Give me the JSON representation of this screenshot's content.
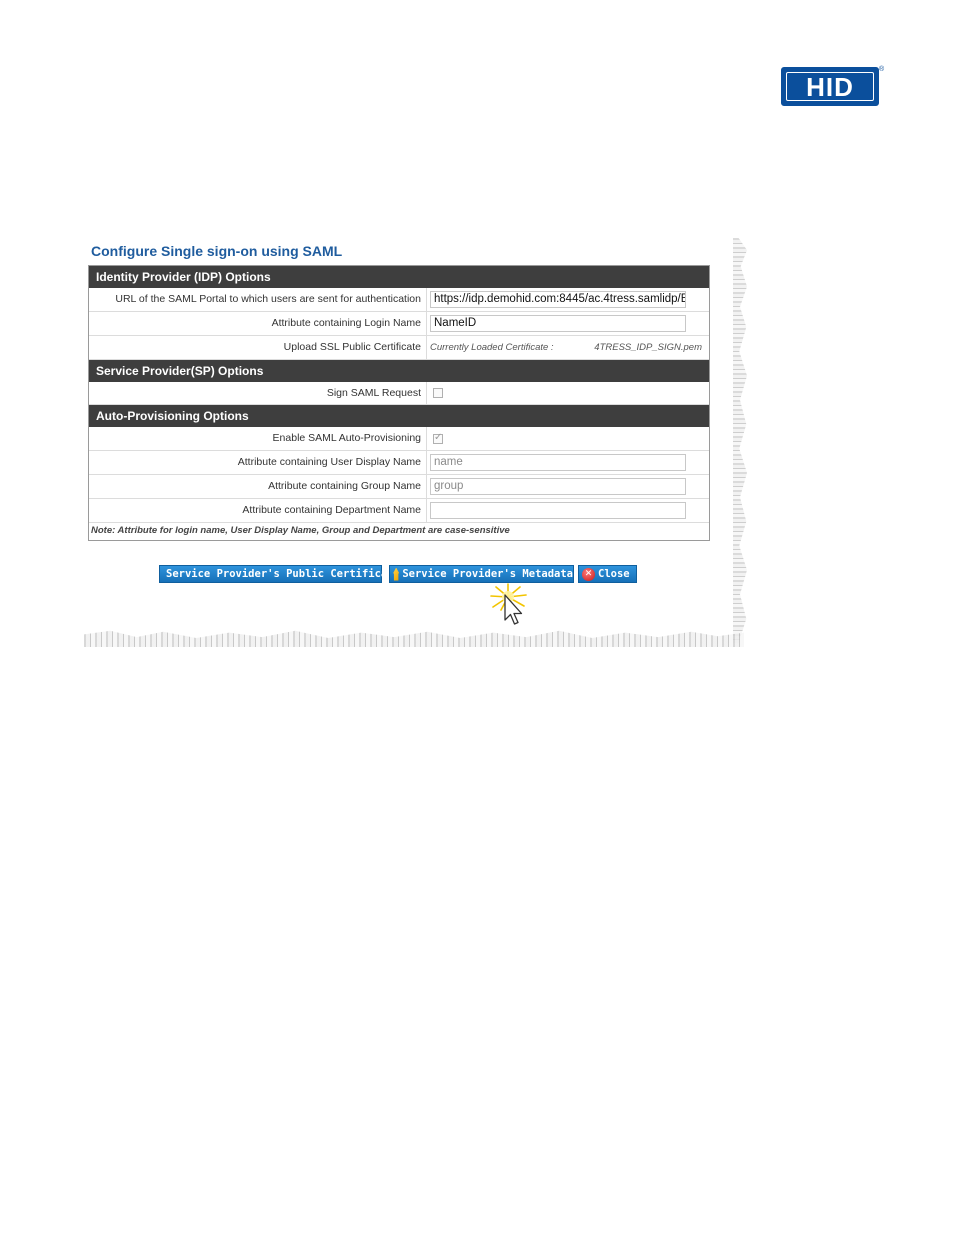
{
  "logo": {
    "text": "HID",
    "registered": "®"
  },
  "form": {
    "title": "Configure Single sign-on using SAML",
    "sections": {
      "idp": {
        "title": "Identity Provider (IDP) Options",
        "portal_url_label": "URL of the SAML Portal to which users are sent for authentication",
        "portal_url_value": "https://idp.demohid.com:8445/ac.4tress.samlidp/E",
        "login_name_label": "Attribute containing Login Name",
        "login_name_value": "NameID",
        "cert_label": "Upload SSL Public Certificate",
        "cert_caption": "Currently Loaded Certificate :",
        "cert_file": "4TRESS_IDP_SIGN.pem"
      },
      "sp": {
        "title": "Service Provider(SP) Options",
        "sign_request_label": "Sign SAML Request",
        "sign_request_checked": false
      },
      "auto": {
        "title": "Auto-Provisioning Options",
        "enable_label": "Enable SAML Auto-Provisioning",
        "enable_checked": true,
        "display_name_label": "Attribute containing User Display Name",
        "display_name_value": "name",
        "group_label": "Attribute containing Group Name",
        "group_value": "group",
        "department_label": "Attribute containing Department Name",
        "department_value": ""
      }
    },
    "note": "Note: Attribute for login name, User Display Name, Group and Department are case-sensitive"
  },
  "buttons": {
    "public_cert": {
      "label": "Service Provider's Public Certificate",
      "icon": "house-icon"
    },
    "metadata": {
      "label": "Service Provider's Metadata",
      "icon": "house-icon"
    },
    "close": {
      "label": "Close",
      "icon": "close-icon"
    }
  },
  "colors": {
    "brand": "#0b4f9c",
    "title": "#1f5c9e",
    "section_header": "#3e3e3e",
    "button": "#1d7fc9"
  }
}
